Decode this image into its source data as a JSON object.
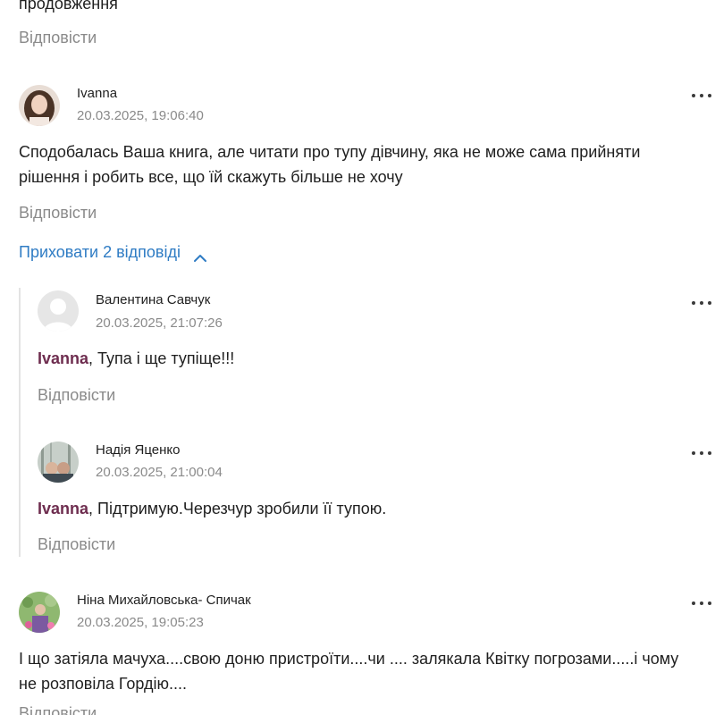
{
  "previous_comment": {
    "text_tail": "продовження",
    "reply_label": "Відповісти"
  },
  "comments": [
    {
      "author": "Ivanna",
      "timestamp": "20.03.2025, 19:06:40",
      "text": "Сподобалась Ваша книга, але читати про тупу дівчину, яка не може сама прийняти рішення і робить все, що їй скажуть більше не хочу",
      "reply_label": "Відповісти",
      "toggle_label": "Приховати 2 відповіді",
      "replies": [
        {
          "author": "Валентина Савчук",
          "timestamp": "20.03.2025, 21:07:26",
          "mention": "Ivanna",
          "text": ", Тупа і ще тупіще!!!",
          "reply_label": "Відповісти"
        },
        {
          "author": "Надія Яценко",
          "timestamp": "20.03.2025, 21:00:04",
          "mention": "Ivanna",
          "text": ", Підтримую.Черезчур зробили її тупою.",
          "reply_label": "Відповісти"
        }
      ]
    },
    {
      "author": "Ніна Михайловська- Спичак",
      "timestamp": "20.03.2025, 19:05:23",
      "text": "І що затіяла мачуха....свою доню пристроїти....чи .... залякала Квітку погрозами.....і чому не розповіла Гордію....",
      "reply_label": "Відповісти"
    }
  ],
  "icons": {
    "more": "more-options-icon",
    "chevron": "chevron-up-icon",
    "avatar_placeholder": "user-placeholder-icon"
  },
  "colors": {
    "accent_blue": "#2f7cc4",
    "mention": "#6e2d4f",
    "muted": "#8a8a8a",
    "thread_line": "#e3e3e3"
  }
}
